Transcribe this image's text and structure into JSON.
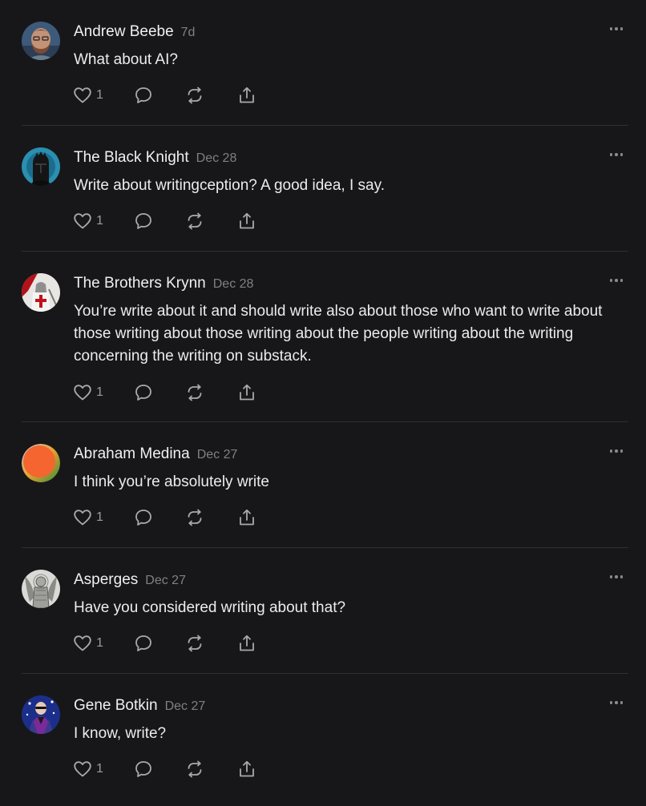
{
  "comments": [
    {
      "author": "Andrew Beebe",
      "date": "7d",
      "text": "What about AI?",
      "likes": "1",
      "avatar": "photo-avatar-andrew"
    },
    {
      "author": "The Black Knight",
      "date": "Dec 28",
      "text": "Write about writingception? A good idea, I say.",
      "likes": "1",
      "avatar": "knight-avatar"
    },
    {
      "author": "The Brothers Krynn",
      "date": "Dec 28",
      "text": "You’re write about it and should write also about those who want to write about those writing about those writing about the people writing about the writing concerning the writing on substack.",
      "likes": "1",
      "avatar": "crusader-avatar"
    },
    {
      "author": "Abraham Medina",
      "date": "Dec 27",
      "text": "I think you’re absolutely write",
      "likes": "1",
      "avatar": "gradient-orb-avatar"
    },
    {
      "author": "Asperges",
      "date": "Dec 27",
      "text": "Have you considered writing about that?",
      "likes": "1",
      "avatar": "angel-engraving-avatar"
    },
    {
      "author": "Gene Botkin",
      "date": "Dec 27",
      "text": "I know, write?",
      "likes": "1",
      "avatar": "bald-figure-avatar"
    }
  ],
  "icons": {
    "like": "heart-icon",
    "reply": "comment-bubble-icon",
    "restack": "restack-arrows-icon",
    "share": "share-upload-icon",
    "more": "more-dots-icon"
  },
  "colors": {
    "background": "#17171a",
    "text": "#ececee",
    "muted": "#7f7f86",
    "divider": "#2f2f34"
  }
}
